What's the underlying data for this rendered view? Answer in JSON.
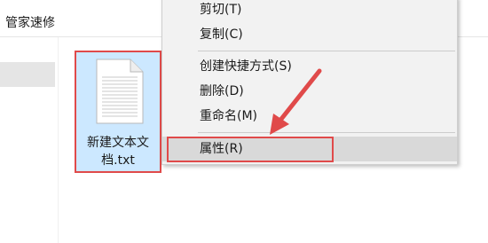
{
  "address_bar": {
    "text": "管家速修"
  },
  "file": {
    "name": "新建文本文档.txt"
  },
  "context_menu": {
    "items": [
      {
        "label": "剪切(T)"
      },
      {
        "label": "复制(C)"
      },
      {
        "label": "创建快捷方式(S)"
      },
      {
        "label": "删除(D)"
      },
      {
        "label": "重命名(M)"
      },
      {
        "label": "属性(R)"
      }
    ]
  },
  "colors": {
    "highlight_red": "#e04a4a",
    "selection_blue": "#cce8ff",
    "menu_bg": "#f2f2f2"
  },
  "icons": [
    "text-file-icon",
    "red-arrow-icon"
  ]
}
